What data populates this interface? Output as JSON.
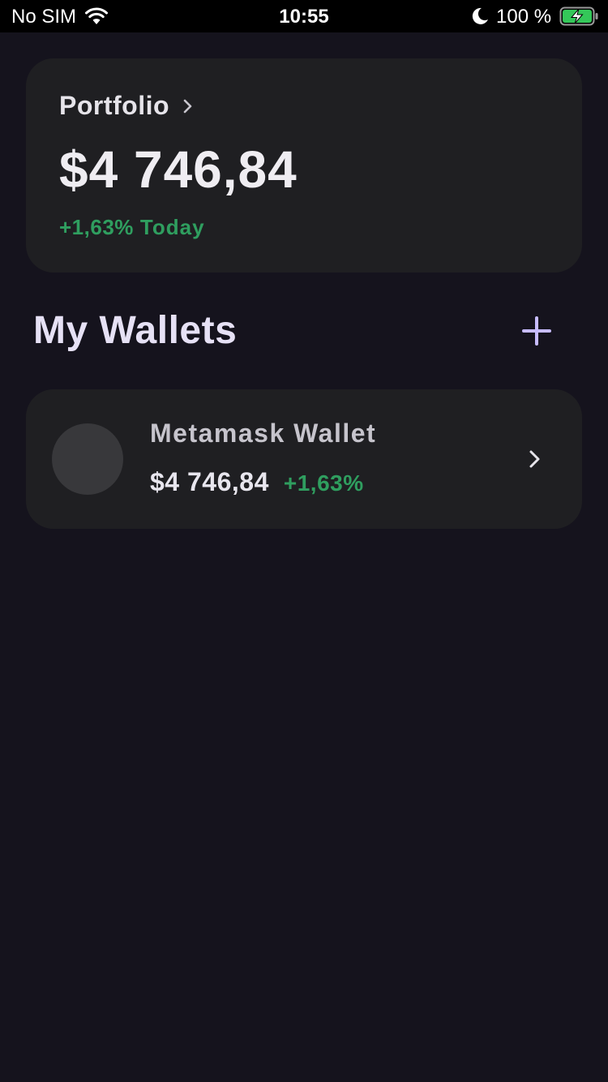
{
  "status_bar": {
    "carrier": "No SIM",
    "time": "10:55",
    "battery_percent": "100 %",
    "battery_fill": 1.0,
    "icons": [
      "wifi-icon",
      "moon-icon",
      "battery-charging-icon"
    ]
  },
  "portfolio": {
    "title": "Portfolio",
    "value": "$4 746,84",
    "change": "+1,63%",
    "period": "Today",
    "icon": "chevron-right-icon"
  },
  "wallets_section": {
    "title": "My Wallets",
    "add_icon": "plus-icon"
  },
  "wallets": [
    {
      "name": "Metamask Wallet",
      "value": "$4 746,84",
      "change": "+1,63%",
      "icon": "chevron-right-icon"
    }
  ],
  "colors": {
    "background": "#15131d",
    "card": "#1f1f22",
    "positive": "#2f9e5f",
    "accent": "#c7bcff",
    "status_bar": "#000000"
  }
}
